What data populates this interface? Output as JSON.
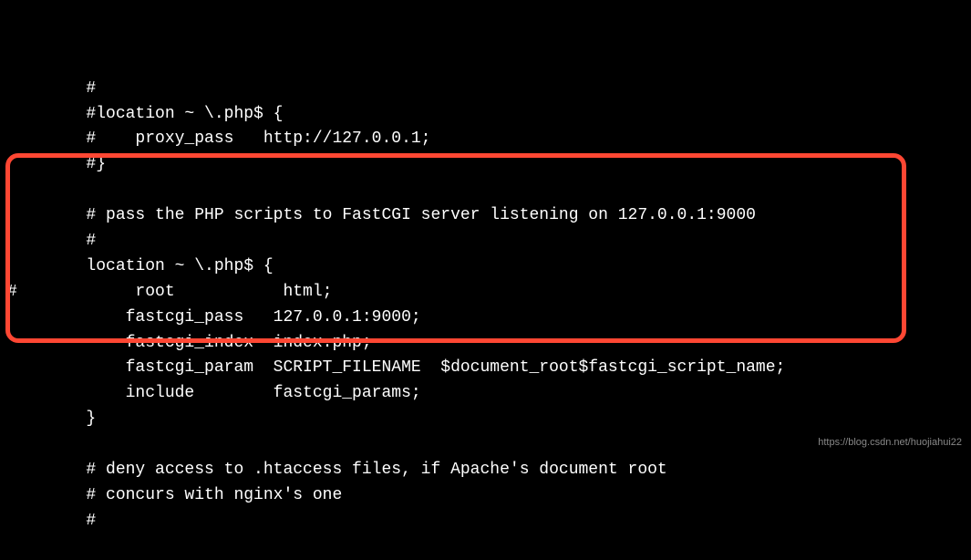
{
  "code": {
    "lines": [
      "        #",
      "        #location ~ \\.php$ {",
      "        #    proxy_pass   http://127.0.0.1;",
      "        #}",
      "",
      "        # pass the PHP scripts to FastCGI server listening on 127.0.0.1:9000",
      "        #",
      "        location ~ \\.php$ {",
      "#            root           html;",
      "            fastcgi_pass   127.0.0.1:9000;",
      "            fastcgi_index  index.php;",
      "            fastcgi_param  SCRIPT_FILENAME  $document_root$fastcgi_script_name;",
      "            include        fastcgi_params;",
      "        }",
      "",
      "        # deny access to .htaccess files, if Apache's document root",
      "        # concurs with nginx's one",
      "        #"
    ]
  },
  "watermark": "https://blog.csdn.net/huojiahui22"
}
